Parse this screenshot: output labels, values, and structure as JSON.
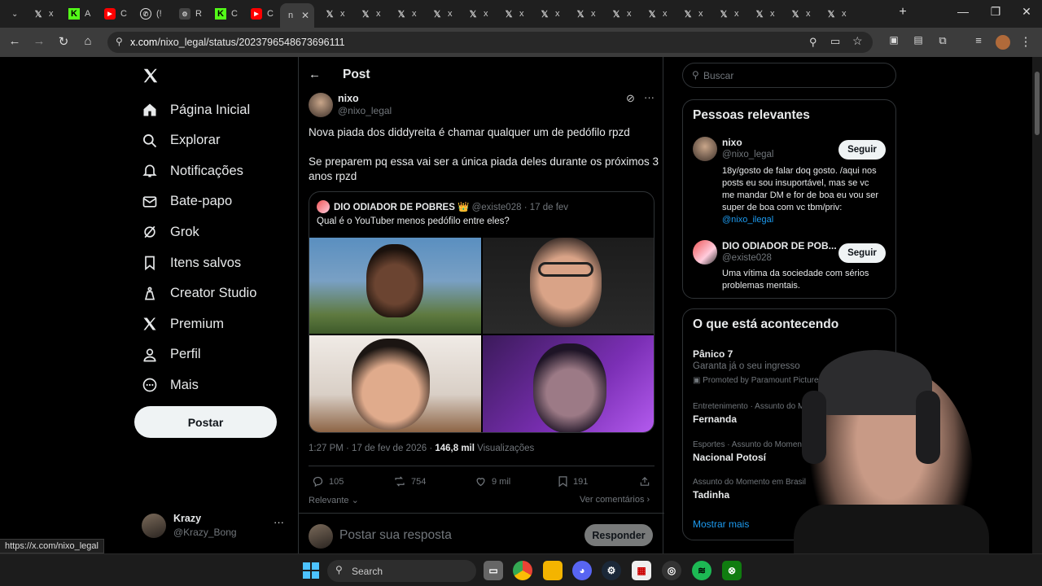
{
  "browser": {
    "tabs": [
      {
        "label": "x",
        "icon": "x-logo-icon"
      },
      {
        "label": "A",
        "icon": "kick-icon"
      },
      {
        "label": "C",
        "icon": "youtube-icon"
      },
      {
        "label": "(!",
        "icon": "whatsapp-icon"
      },
      {
        "label": "R",
        "icon": "generic-icon"
      },
      {
        "label": "C",
        "icon": "kick-icon"
      },
      {
        "label": "C",
        "icon": "youtube-icon"
      },
      {
        "label": "n",
        "icon": "x-logo-icon"
      },
      {
        "label": "x"
      },
      {
        "label": "x"
      },
      {
        "label": "x"
      },
      {
        "label": "x"
      },
      {
        "label": "x"
      },
      {
        "label": "x"
      },
      {
        "label": "x"
      },
      {
        "label": "x"
      },
      {
        "label": "x"
      },
      {
        "label": "x"
      },
      {
        "label": "x"
      },
      {
        "label": "x"
      },
      {
        "label": "x"
      },
      {
        "label": "x"
      },
      {
        "label": "x"
      }
    ],
    "url_domain": "x.com",
    "url_path": "/nixo_legal/status/2023796548673696111",
    "status_url": "https://x.com/nixo_legal"
  },
  "sidebar": {
    "items": [
      {
        "label": "Página Inicial",
        "icon": "home-icon"
      },
      {
        "label": "Explorar",
        "icon": "search-icon"
      },
      {
        "label": "Notificações",
        "icon": "bell-icon"
      },
      {
        "label": "Bate-papo",
        "icon": "mail-icon"
      },
      {
        "label": "Grok",
        "icon": "grok-icon"
      },
      {
        "label": "Itens salvos",
        "icon": "bookmark-icon"
      },
      {
        "label": "Creator Studio",
        "icon": "flask-icon"
      },
      {
        "label": "Premium",
        "icon": "x-logo-icon"
      },
      {
        "label": "Perfil",
        "icon": "user-icon"
      },
      {
        "label": "Mais",
        "icon": "more-circle-icon"
      }
    ],
    "post_button": "Postar",
    "account": {
      "name": "Krazy",
      "handle": "@Krazy_Bong"
    }
  },
  "post": {
    "header": "Post",
    "author": {
      "name": "nixo",
      "handle": "@nixo_legal"
    },
    "text_line1": "Nova piada dos diddyreita é chamar qualquer um de pedófilo rpzd",
    "text_line2a": "Se preparem pq essa vai ser a única piada deles durante os próximos 3",
    "text_line2b": "anos rpzd",
    "quote": {
      "author": "DIO ODIADOR DE POBRES 👑",
      "handle": "@existe028",
      "date": "· 17 de fev",
      "text": "Qual é o YouTuber menos pedófilo entre eles?"
    },
    "time": "1:27 PM · 17 de fev de 2026 ·",
    "views": "146,8 mil",
    "views_label": "Visualizações",
    "stats": {
      "replies": "105",
      "reposts": "754",
      "likes": "9 mil",
      "bookmarks": "191"
    },
    "sort_label": "Relevante",
    "see_comments": "Ver comentários",
    "reply_placeholder": "Postar sua resposta",
    "reply_button": "Responder"
  },
  "right": {
    "search_placeholder": "Buscar",
    "relevant_title": "Pessoas relevantes",
    "people": [
      {
        "name": "nixo",
        "handle": "@nixo_legal",
        "follow": "Seguir",
        "bio1": "18y/gosto de falar doq gosto. /aqui nos",
        "bio2": "posts eu sou insuportável, mas se vc",
        "bio3": "me mandar DM e for de boa eu vou ser",
        "bio4": "super de boa com vc tbm/priv:",
        "link": "@nixo_ilegal"
      },
      {
        "name": "DIO ODIADOR DE POB...",
        "handle": "@existe028",
        "follow": "Seguir",
        "bio1": "Uma vítima da sociedade com sérios",
        "bio2": "problemas mentais."
      }
    ],
    "happening_title": "O que está acontecendo",
    "trends": [
      {
        "name": "Pânico 7",
        "sub": "Garanta já o seu ingresso",
        "promo": "Promoted by Paramount Pictures"
      },
      {
        "category": "Entretenimento · Assunto do Momento",
        "name": "Fernanda"
      },
      {
        "category": "Esportes · Assunto do Momento",
        "name": "Nacional Potosí"
      },
      {
        "category": "Assunto do Momento em Brasil",
        "name": "Tadinha"
      }
    ],
    "show_more": "Mostrar mais"
  },
  "taskbar": {
    "search": "Search"
  },
  "colors": {
    "accent": "#1d9bf0",
    "bg": "#000000",
    "border": "#2f3336",
    "muted": "#71767b"
  }
}
